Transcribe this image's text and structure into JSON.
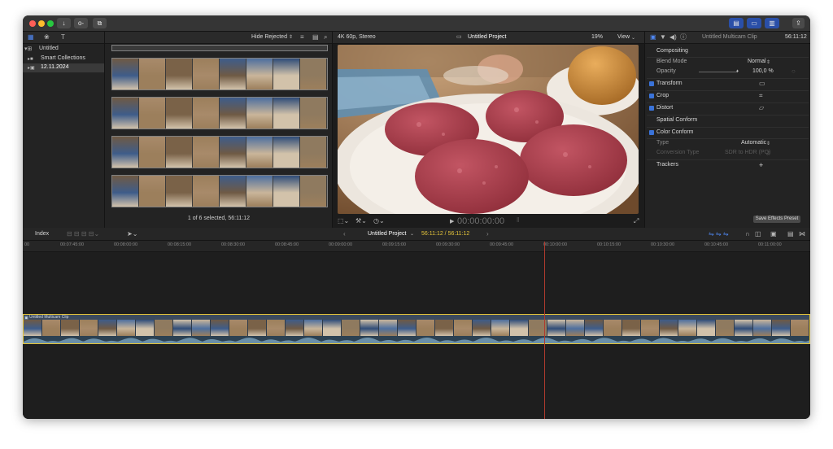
{
  "window": {
    "toolbar_icons": [
      "import-icon",
      "key-icon",
      "share-stack-icon"
    ],
    "view_toggle_icons": [
      "browser-layout-icon",
      "timeline-layout-icon",
      "inspector-layout-icon"
    ],
    "share_icon": "share-icon"
  },
  "sidebar": {
    "items": [
      {
        "label": "Untitled",
        "icon": "library-icon"
      },
      {
        "label": "Smart Collections",
        "icon": "folder-icon"
      },
      {
        "label": "12.11.2024",
        "icon": "event-icon"
      }
    ]
  },
  "browser": {
    "filter_label": "Hide Rejected",
    "status": "1 of 6 selected, 56:11:12"
  },
  "viewer": {
    "format": "4K 60p, Stereo",
    "title": "Untitled Project",
    "zoom": "19%",
    "view_label": "View",
    "timecode": "00:00:00:00"
  },
  "inspector": {
    "clip_name": "Untitled Multicam Clip",
    "duration": "56:11:12",
    "sections": {
      "compositing": "Compositing",
      "blend_mode_label": "Blend Mode",
      "blend_mode_value": "Normal",
      "opacity_label": "Opacity",
      "opacity_value": "100,0 %",
      "transform": "Transform",
      "crop": "Crop",
      "distort": "Distort",
      "spatial_conform": "Spatial Conform",
      "color_conform": "Color Conform",
      "type_label": "Type",
      "type_value": "Automatic",
      "conversion_label": "Conversion Type",
      "conversion_value": "SDR to HDR (PQ)",
      "trackers": "Trackers",
      "trackers_add": "+"
    },
    "save_preset": "Save Effects Preset"
  },
  "timeline": {
    "index_label": "Index",
    "project_name": "Untitled Project",
    "timecode": "56:11:12 / 56:11:12",
    "ruler_labels": [
      "00:07:45:00",
      "00:08:00:00",
      "00:08:15:00",
      "00:08:30:00",
      "00:08:45:00",
      "00:09:00:00",
      "00:09:15:00",
      "00:09:30:00",
      "00:09:45:00",
      "00:10:00:00",
      "00:10:15:00",
      "00:10:30:00",
      "00:10:45:00",
      "00:11:00:00"
    ],
    "clip_label": "Untitled Multicam Clip",
    "accent_color": "#e3c33a",
    "playhead_color": "#b03a2e"
  }
}
